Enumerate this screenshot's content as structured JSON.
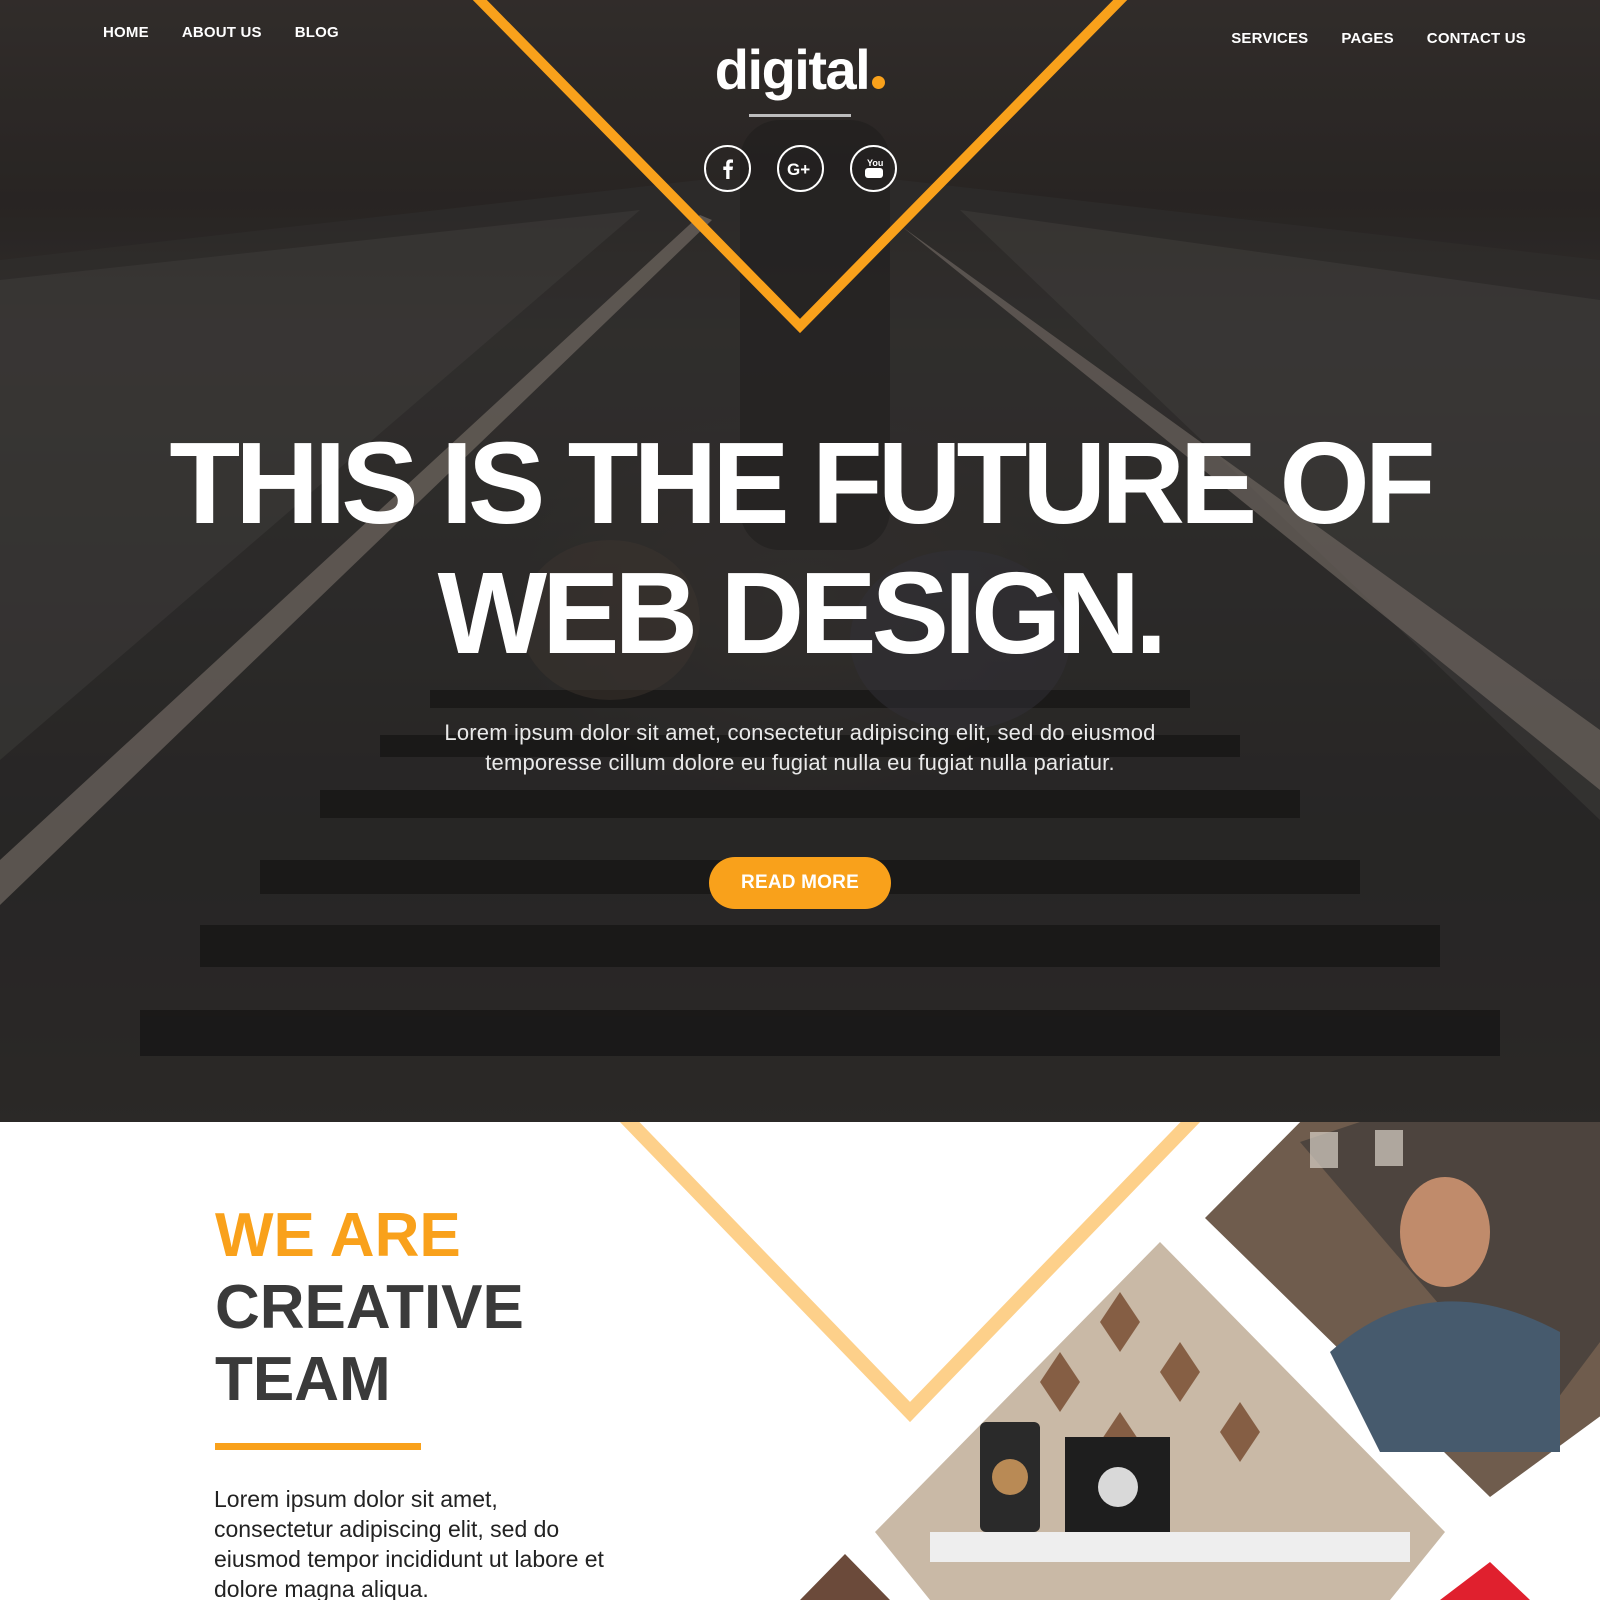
{
  "nav": {
    "left": [
      "HOME",
      "ABOUT US",
      "BLOG"
    ],
    "right": [
      "SERVICES",
      "PAGES",
      "CONTACT US"
    ]
  },
  "logo": {
    "text": "digital"
  },
  "social": [
    "facebook-icon",
    "google-plus-icon",
    "youtube-icon"
  ],
  "hero": {
    "headline_line1": "THIS IS THE FUTURE OF",
    "headline_line2": "WEB DESIGN.",
    "text_line1": "Lorem ipsum dolor sit amet, consectetur adipiscing elit, sed do eiusmod",
    "text_line2": "temporesse cillum dolore eu fugiat nulla eu fugiat nulla pariatur.",
    "button": "READ MORE"
  },
  "about": {
    "title_accent": "WE ARE",
    "title_line2": "CREATIVE",
    "title_line3": "TEAM",
    "text": "Lorem ipsum dolor sit amet, consectetur adipiscing elit, sed do eiusmod tempor incididunt ut labore et dolore magna aliqua."
  },
  "colors": {
    "accent": "#f9a11b",
    "accent_light": "#fdd08a",
    "dark_text": "#3a3a3a",
    "hero_bg": "#2a2726"
  }
}
